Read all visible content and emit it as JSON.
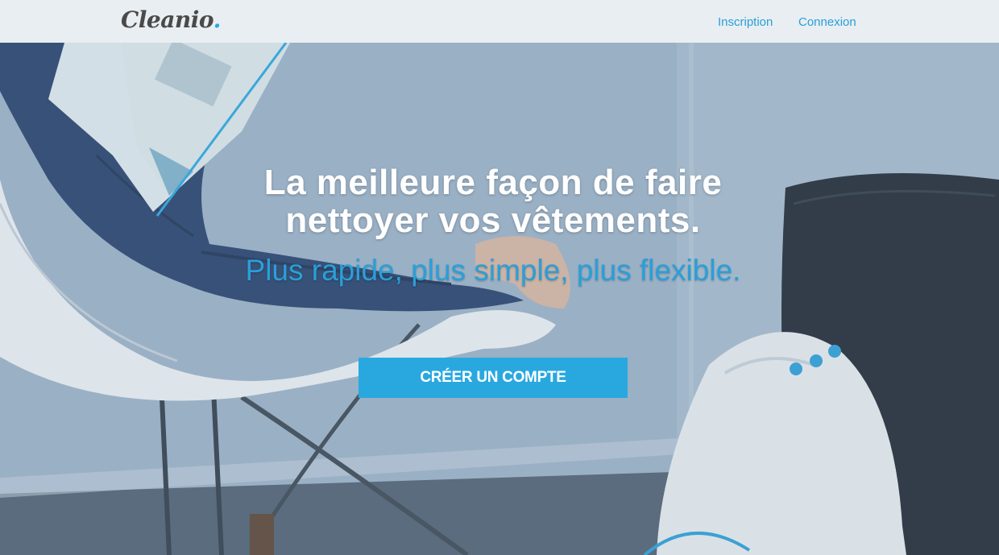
{
  "header": {
    "logo_text": "Cleanio",
    "logo_dot": ".",
    "nav": {
      "signup_label": "Inscription",
      "login_label": "Connexion"
    }
  },
  "hero": {
    "headline_line1": "La meilleure façon de faire",
    "headline_line2": "nettoyer vos vêtements.",
    "tagline": "Plus rapide, plus simple, plus flexible.",
    "cta_label": "CRÉER UN COMPTE"
  },
  "colors": {
    "accent": "#29a8e0",
    "topbar_bg": "#e8eef1",
    "logo_text": "#4a4a4a"
  }
}
